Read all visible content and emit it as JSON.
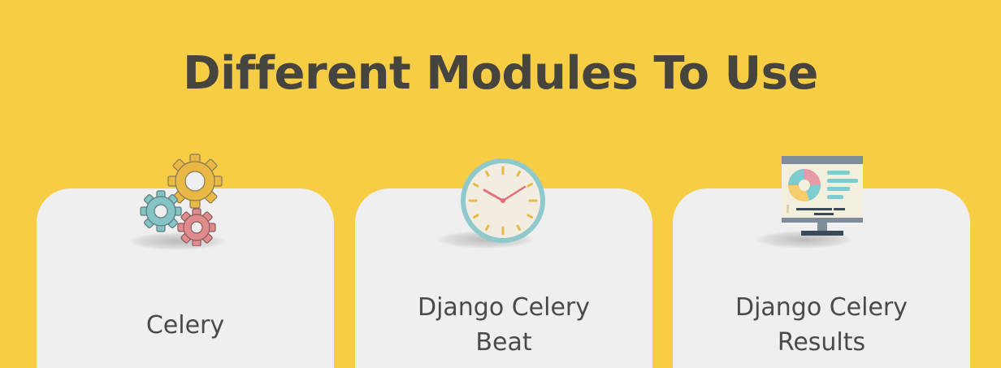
{
  "heading": "Different Modules To Use",
  "colors": {
    "background": "#f6cd45",
    "card": "#efefef",
    "text": "#45443f"
  },
  "cards": [
    {
      "label_line1": "Celery",
      "label_line2": "",
      "icon": "gears-icon"
    },
    {
      "label_line1": "Django Celery",
      "label_line2": "Beat",
      "icon": "clock-icon"
    },
    {
      "label_line1": "Django Celery",
      "label_line2": "Results",
      "icon": "monitor-chart-icon"
    }
  ]
}
